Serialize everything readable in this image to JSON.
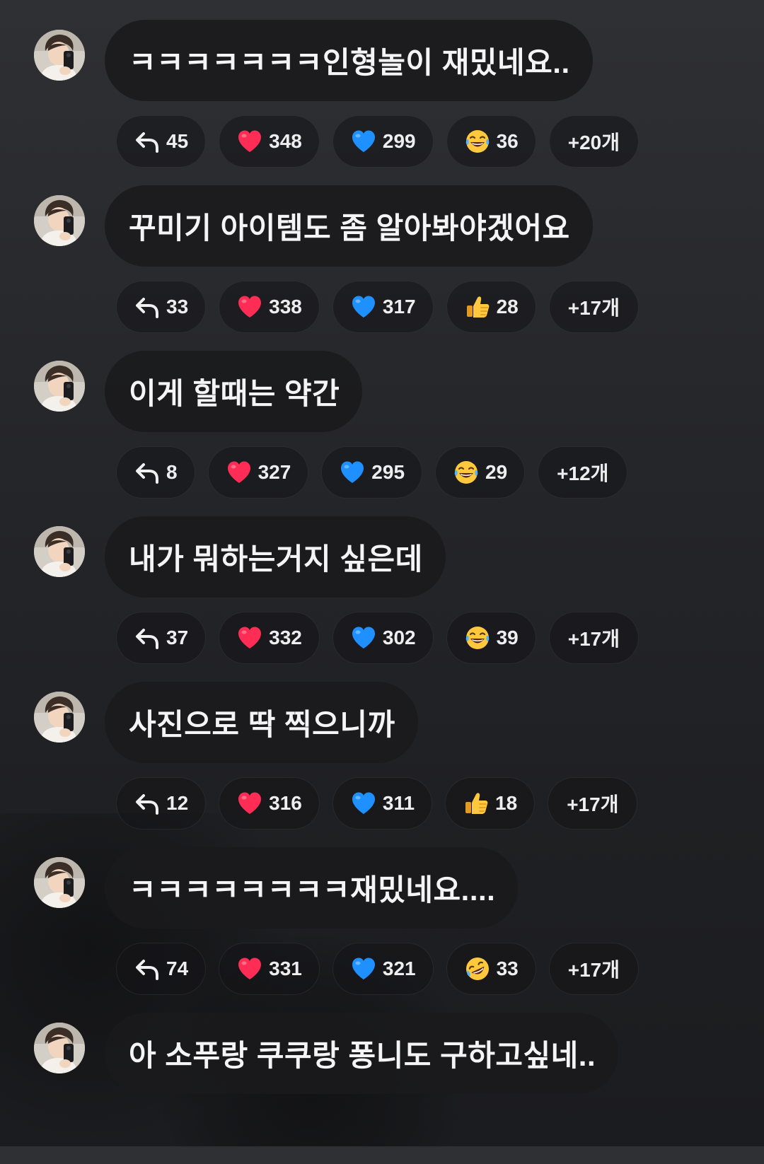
{
  "comments": [
    {
      "text": "ㅋㅋㅋㅋㅋㅋㅋ인형놀이 재밌네요..",
      "reactions": [
        {
          "icon": "reply-arrow-icon",
          "count": "45"
        },
        {
          "icon": "red-heart-icon",
          "count": "348"
        },
        {
          "icon": "blue-heart-icon",
          "count": "299"
        },
        {
          "icon": "laughing-tears-icon",
          "count": "36"
        }
      ],
      "more": "+20개"
    },
    {
      "text": "꾸미기 아이템도 좀 알아봐야겠어요",
      "reactions": [
        {
          "icon": "reply-arrow-icon",
          "count": "33"
        },
        {
          "icon": "red-heart-icon",
          "count": "338"
        },
        {
          "icon": "blue-heart-icon",
          "count": "317"
        },
        {
          "icon": "thumbs-up-icon",
          "count": "28"
        }
      ],
      "more": "+17개"
    },
    {
      "text": "이게 할때는 약간",
      "reactions": [
        {
          "icon": "reply-arrow-icon",
          "count": "8"
        },
        {
          "icon": "red-heart-icon",
          "count": "327"
        },
        {
          "icon": "blue-heart-icon",
          "count": "295"
        },
        {
          "icon": "laughing-tears-icon",
          "count": "29"
        }
      ],
      "more": "+12개"
    },
    {
      "text": "내가 뭐하는거지 싶은데",
      "reactions": [
        {
          "icon": "reply-arrow-icon",
          "count": "37"
        },
        {
          "icon": "red-heart-icon",
          "count": "332"
        },
        {
          "icon": "blue-heart-icon",
          "count": "302"
        },
        {
          "icon": "laughing-tears-icon",
          "count": "39"
        }
      ],
      "more": "+17개"
    },
    {
      "text": "사진으로 딱 찍으니까",
      "reactions": [
        {
          "icon": "reply-arrow-icon",
          "count": "12"
        },
        {
          "icon": "red-heart-icon",
          "count": "316"
        },
        {
          "icon": "blue-heart-icon",
          "count": "311"
        },
        {
          "icon": "thumbs-up-icon",
          "count": "18"
        }
      ],
      "more": "+17개"
    },
    {
      "text": "ㅋㅋㅋㅋㅋㅋㅋㅋ재밌네요....",
      "reactions": [
        {
          "icon": "reply-arrow-icon",
          "count": "74"
        },
        {
          "icon": "red-heart-icon",
          "count": "331"
        },
        {
          "icon": "blue-heart-icon",
          "count": "321"
        },
        {
          "icon": "rolling-laughing-icon",
          "count": "33"
        }
      ],
      "more": "+17개"
    },
    {
      "text": "아 소푸랑 쿠쿠랑 퐁니도 구하고싶네..",
      "reactions": [],
      "more": ""
    }
  ],
  "colors": {
    "bubble": "#1a1a1d",
    "chip_border": "#3a3a3e",
    "red_heart": "#ff2d55",
    "blue_heart": "#1e90ff",
    "emoji_yellow": "#ffc83d"
  }
}
